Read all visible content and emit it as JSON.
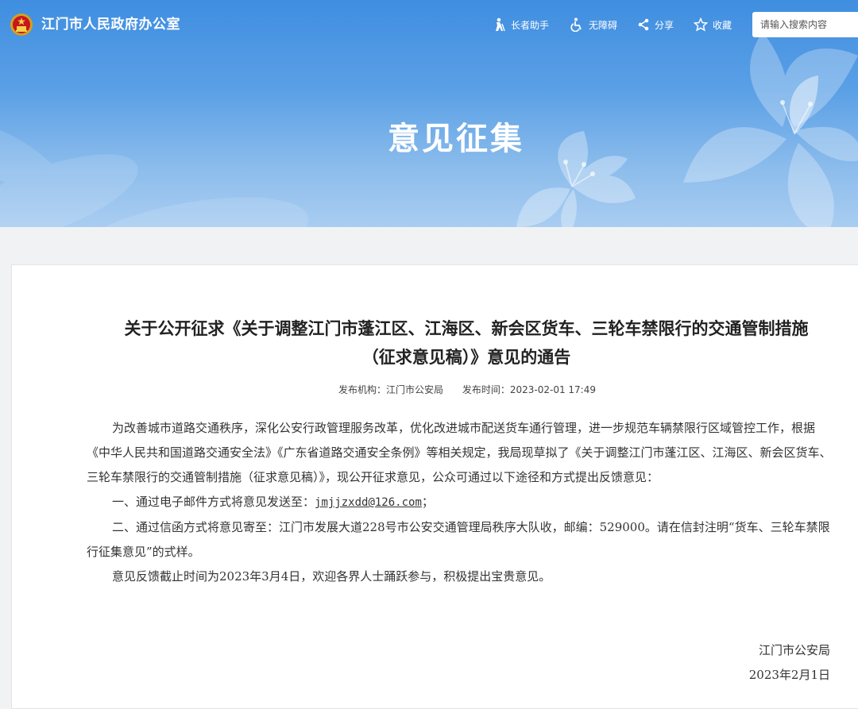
{
  "header": {
    "site_name": "江门市人民政府办公室",
    "tools": [
      {
        "label": "长者助手",
        "icon": "elder-assist-icon"
      },
      {
        "label": "无障碍",
        "icon": "accessibility-icon"
      },
      {
        "label": "分享",
        "icon": "share-icon"
      },
      {
        "label": "收藏",
        "icon": "star-icon"
      }
    ],
    "search_placeholder": "请输入搜索内容"
  },
  "banner": {
    "title": "意见征集"
  },
  "article": {
    "title_line1": "关于公开征求《关于调整江门市蓬江区、江海区、新会区货车、三轮车禁限行的交通管制措施",
    "title_line2": "（征求意见稿）》意见的通告",
    "publisher_label": "发布机构：",
    "publisher": "江门市公安局",
    "time_label": "发布时间：",
    "time": "2023-02-01 17:49",
    "para1": "为改善城市道路交通秩序，深化公安行政管理服务改革，优化改进城市配送货车通行管理，进一步规范车辆禁限行区域管控工作，根据《中华人民共和国道路交通安全法》《广东省道路交通安全条例》等相关规定，我局现草拟了《关于调整江门市蓬江区、江海区、新会区货车、三轮车禁限行的交通管制措施（征求意见稿）》，现公开征求意见，公众可通过以下途径和方式提出反馈意见：",
    "para2_prefix": "一、通过电子邮件方式将意见发送至：",
    "email": "jmjjzxdd@126.com",
    "para2_suffix": "；",
    "para3": "二、通过信函方式将意见寄至：江门市发展大道228号市公安交通管理局秩序大队收，邮编：529000。请在信封注明“货车、三轮车禁限行征集意见”的式样。",
    "para4": "意见反馈截止时间为2023年3月4日，欢迎各界人士踊跃参与，积极提出宝贵意见。",
    "sign_org": "江门市公安局",
    "sign_date": "2023年2月1日"
  }
}
